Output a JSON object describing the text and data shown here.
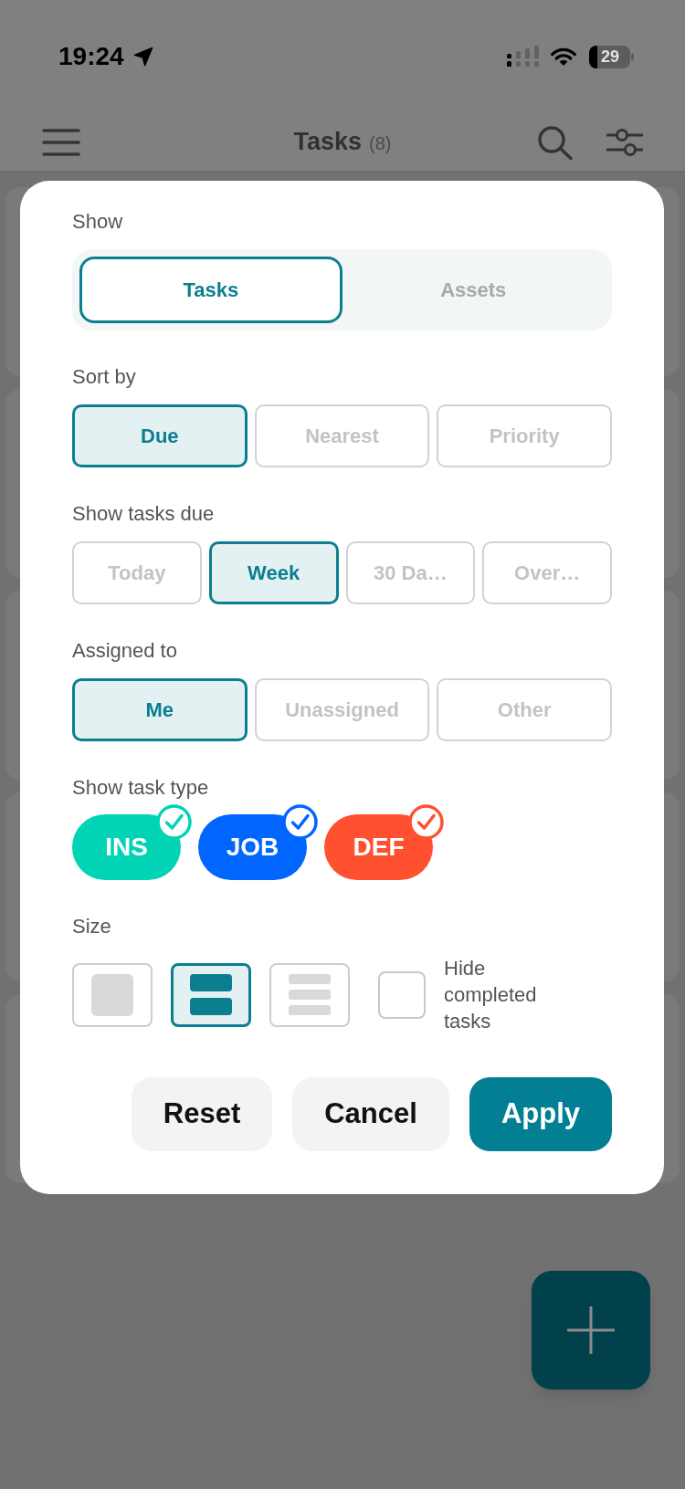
{
  "status_bar": {
    "time": "19:24",
    "battery": "29"
  },
  "header": {
    "title": "Tasks",
    "count": "(8)"
  },
  "filter_sheet": {
    "sections": [
      {
        "kind": "segmented",
        "label": "Show",
        "options": [
          {
            "label": "Tasks",
            "selected": true
          },
          {
            "label": "Assets",
            "selected": false
          }
        ]
      },
      {
        "kind": "buttons",
        "label": "Sort by",
        "options": [
          {
            "label": "Due",
            "selected": true
          },
          {
            "label": "Nearest",
            "selected": false
          },
          {
            "label": "Priority",
            "selected": false
          }
        ]
      },
      {
        "kind": "buttons",
        "label": "Show tasks due",
        "options": [
          {
            "label": "Today",
            "selected": false
          },
          {
            "label": "Week",
            "selected": true
          },
          {
            "label": "30 Da…",
            "selected": false
          },
          {
            "label": "Over…",
            "selected": false
          }
        ]
      },
      {
        "kind": "buttons",
        "label": "Assigned to",
        "options": [
          {
            "label": "Me",
            "selected": true
          },
          {
            "label": "Unassigned",
            "selected": false
          },
          {
            "label": "Other",
            "selected": false
          }
        ]
      },
      {
        "kind": "task_types",
        "label": "Show task type",
        "options": [
          {
            "label": "INS",
            "checked": true,
            "color": "#00d4b4"
          },
          {
            "label": "JOB",
            "checked": true,
            "color": "#0066ff"
          },
          {
            "label": "DEF",
            "checked": true,
            "color": "#ff512f"
          }
        ]
      },
      {
        "kind": "size",
        "label": "Size",
        "options": [
          {
            "kind": "large",
            "selected": false
          },
          {
            "kind": "medium",
            "selected": true
          },
          {
            "kind": "compact",
            "selected": false
          }
        ],
        "hide_completed": {
          "label": "Hide completed tasks",
          "checked": false
        }
      }
    ],
    "actions": [
      {
        "label": "Reset",
        "kind": "secondary"
      },
      {
        "label": "Cancel",
        "kind": "secondary"
      },
      {
        "label": "Apply",
        "kind": "primary"
      }
    ]
  }
}
